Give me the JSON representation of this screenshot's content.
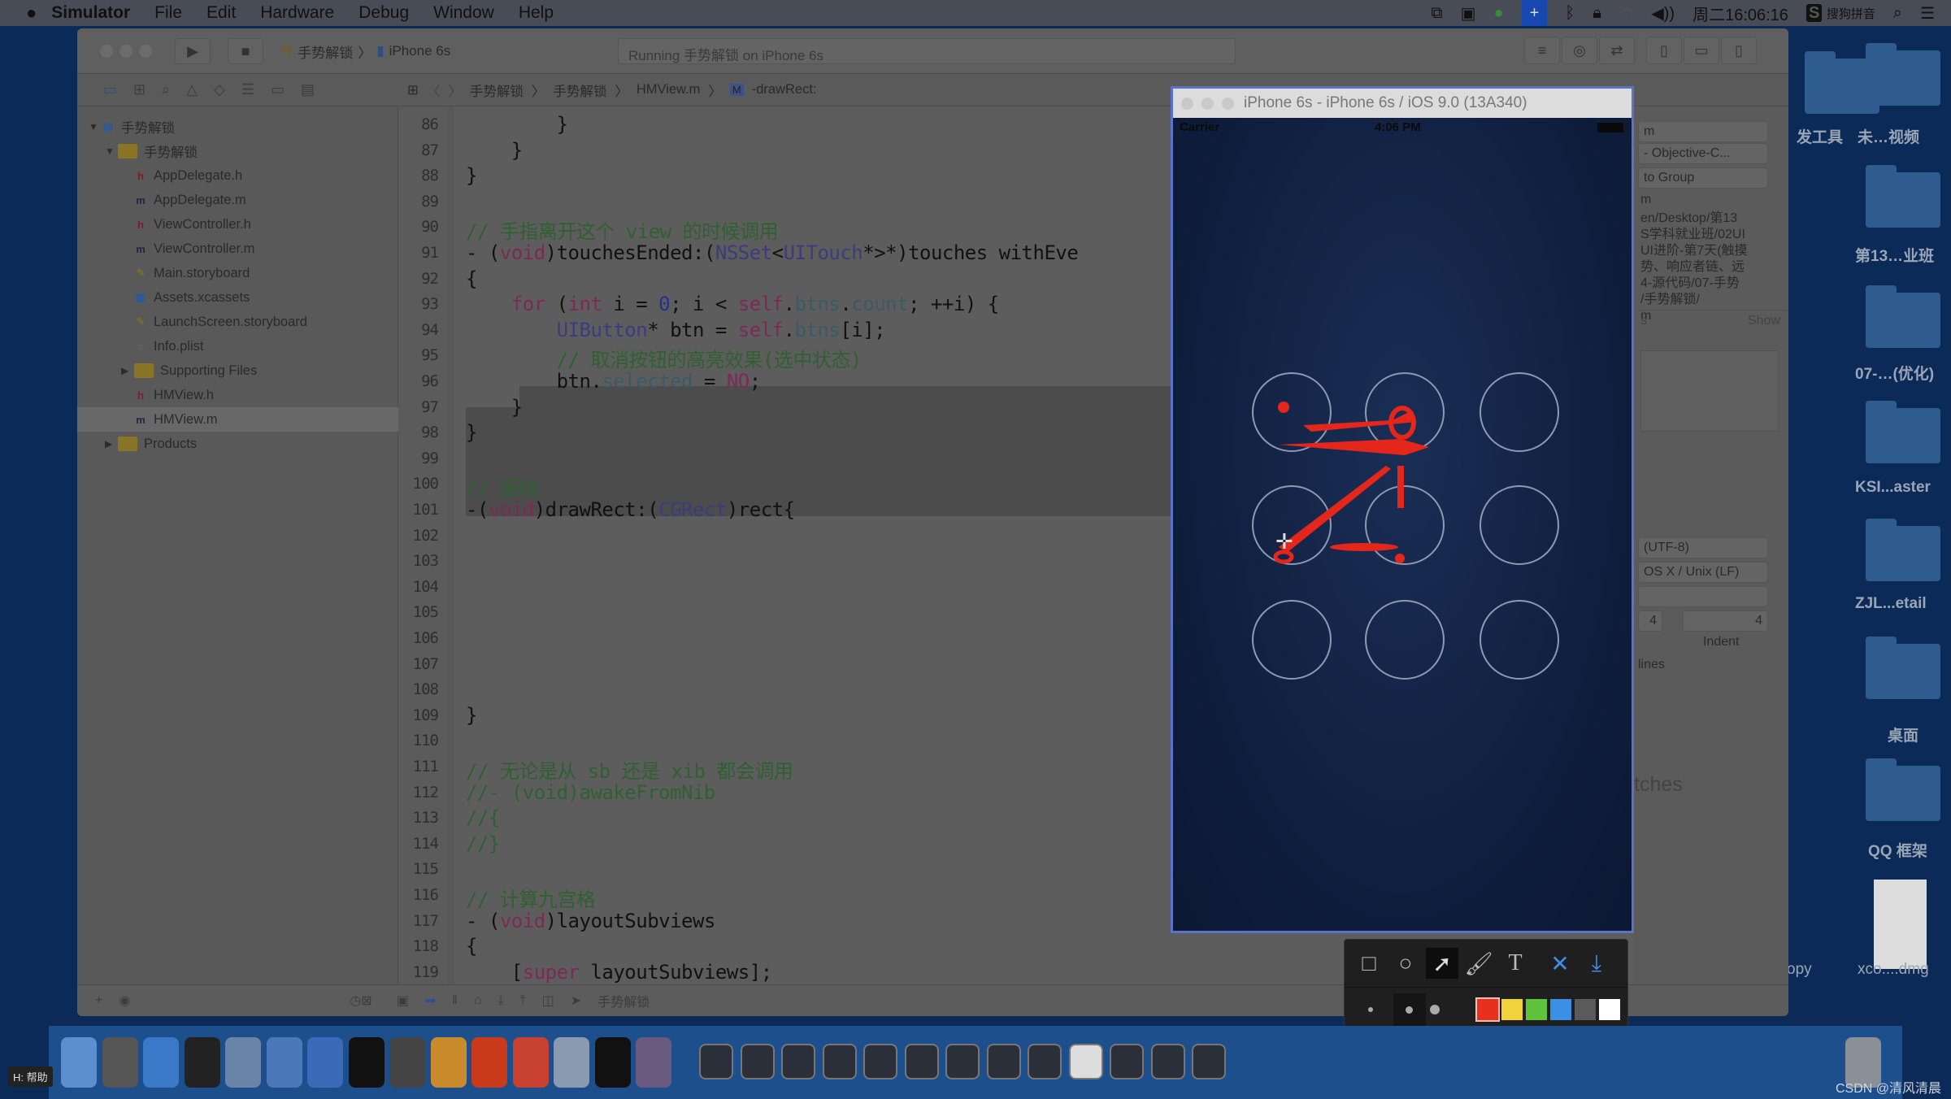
{
  "menubar": {
    "app": "Simulator",
    "items": [
      "File",
      "Edit",
      "Hardware",
      "Debug",
      "Window",
      "Help"
    ],
    "clock": "周二16:06:16",
    "ime": "搜狗拼音"
  },
  "xcode": {
    "scheme": "手势解锁",
    "device": "iPhone 6s",
    "activity": "Running 手势解锁 on iPhone 6s",
    "jumpbar": [
      "手势解锁",
      "手势解锁",
      "HMView.m",
      "-drawRect:"
    ],
    "tree": [
      {
        "label": "手势解锁",
        "type": "project",
        "depth": 0,
        "open": true
      },
      {
        "label": "手势解锁",
        "type": "folder",
        "depth": 1,
        "open": true
      },
      {
        "label": "AppDelegate.h",
        "type": "h",
        "depth": 2
      },
      {
        "label": "AppDelegate.m",
        "type": "m",
        "depth": 2
      },
      {
        "label": "ViewController.h",
        "type": "h",
        "depth": 2
      },
      {
        "label": "ViewController.m",
        "type": "m",
        "depth": 2
      },
      {
        "label": "Main.storyboard",
        "type": "sb",
        "depth": 2
      },
      {
        "label": "Assets.xcassets",
        "type": "assets",
        "depth": 2
      },
      {
        "label": "LaunchScreen.storyboard",
        "type": "sb",
        "depth": 2
      },
      {
        "label": "Info.plist",
        "type": "plist",
        "depth": 2
      },
      {
        "label": "Supporting Files",
        "type": "folder",
        "depth": 2,
        "open": false
      },
      {
        "label": "HMView.h",
        "type": "h",
        "depth": 2
      },
      {
        "label": "HMView.m",
        "type": "m",
        "depth": 2,
        "selected": true
      },
      {
        "label": "Products",
        "type": "folder",
        "depth": 1,
        "open": false
      }
    ],
    "code": [
      {
        "n": "86",
        "t": [
          [
            "        }",
            ""
          ]
        ]
      },
      {
        "n": "87",
        "t": [
          [
            "    }",
            ""
          ]
        ]
      },
      {
        "n": "88",
        "t": [
          [
            "}",
            ""
          ]
        ]
      },
      {
        "n": "89",
        "t": []
      },
      {
        "n": "90",
        "t": [
          [
            "// 手指离开这个 view 的时候调用",
            "cm"
          ]
        ]
      },
      {
        "n": "91",
        "t": [
          [
            "- (",
            ""
          ],
          [
            "void",
            "k"
          ],
          [
            ")touchesEnded:(",
            ""
          ],
          [
            "NSSet",
            "ty"
          ],
          [
            "<",
            ""
          ],
          [
            "UITouch",
            "ty"
          ],
          [
            "*>*)touches withEve",
            ""
          ]
        ]
      },
      {
        "n": "92",
        "t": [
          [
            "{",
            ""
          ]
        ]
      },
      {
        "n": "93",
        "t": [
          [
            "    ",
            ""
          ],
          [
            "for",
            "k"
          ],
          [
            " (",
            ""
          ],
          [
            "int",
            "k"
          ],
          [
            " i = ",
            ""
          ],
          [
            "0",
            "nm"
          ],
          [
            "; i < ",
            ""
          ],
          [
            "self",
            "k"
          ],
          [
            ".",
            ""
          ],
          [
            "btns",
            "pr"
          ],
          [
            ".",
            ""
          ],
          [
            "count",
            "pr"
          ],
          [
            "; ++i) {",
            ""
          ]
        ]
      },
      {
        "n": "94",
        "t": [
          [
            "        ",
            ""
          ],
          [
            "UIButton",
            "ty"
          ],
          [
            "* btn = ",
            ""
          ],
          [
            "self",
            "k"
          ],
          [
            ".",
            ""
          ],
          [
            "btns",
            "pr"
          ],
          [
            "[i];",
            ""
          ]
        ]
      },
      {
        "n": "95",
        "t": [
          [
            "        // 取消按钮的高亮效果(选中状态)",
            "cm"
          ]
        ]
      },
      {
        "n": "96",
        "t": [
          [
            "        btn.",
            ""
          ],
          [
            "selected",
            "pr"
          ],
          [
            " = ",
            ""
          ],
          [
            "NO",
            "k"
          ],
          [
            ";",
            ""
          ]
        ]
      },
      {
        "n": "97",
        "t": [
          [
            "    }",
            ""
          ]
        ]
      },
      {
        "n": "98",
        "t": [
          [
            "}",
            ""
          ]
        ]
      },
      {
        "n": "99",
        "t": []
      },
      {
        "n": "100",
        "t": [
          [
            "// 画线",
            "cm"
          ]
        ]
      },
      {
        "n": "101",
        "t": [
          [
            "-(",
            ""
          ],
          [
            "void",
            "k"
          ],
          [
            ")drawRect:(",
            ""
          ],
          [
            "CGRect",
            "ty"
          ],
          [
            ")rect{",
            ""
          ]
        ]
      },
      {
        "n": "102",
        "t": []
      },
      {
        "n": "103",
        "t": []
      },
      {
        "n": "104",
        "t": []
      },
      {
        "n": "105",
        "t": []
      },
      {
        "n": "106",
        "t": []
      },
      {
        "n": "107",
        "t": []
      },
      {
        "n": "108",
        "t": []
      },
      {
        "n": "109",
        "t": [
          [
            "}",
            ""
          ]
        ]
      },
      {
        "n": "110",
        "t": []
      },
      {
        "n": "111",
        "t": [
          [
            "// 无论是从 sb 还是 xib 都会调用",
            "cm"
          ]
        ]
      },
      {
        "n": "112",
        "t": [
          [
            "//- (void)awakeFromNib",
            "cm"
          ]
        ]
      },
      {
        "n": "113",
        "t": [
          [
            "//{",
            "cm"
          ]
        ]
      },
      {
        "n": "114",
        "t": [
          [
            "//}",
            "cm"
          ]
        ]
      },
      {
        "n": "115",
        "t": []
      },
      {
        "n": "116",
        "t": [
          [
            "// 计算九宫格",
            "cm"
          ]
        ]
      },
      {
        "n": "117",
        "t": [
          [
            "- (",
            ""
          ],
          [
            "void",
            "k"
          ],
          [
            ")layoutSubviews",
            ""
          ]
        ]
      },
      {
        "n": "118",
        "t": [
          [
            "{",
            ""
          ]
        ]
      },
      {
        "n": "119",
        "t": [
          [
            "    [",
            ""
          ],
          [
            "super",
            "k"
          ],
          [
            " layoutSubviews];",
            ""
          ]
        ]
      }
    ],
    "inspector": {
      "name": "m",
      "type": "- Objective-C...",
      "location": "to Group",
      "fullpath_label": "m",
      "path": [
        "en/Desktop/第13",
        "S学科就业班/02UI",
        "UI进阶-第7天(触摸",
        "势、响应者链、远",
        "4-源代码/07-手势",
        "/手势解锁/"
      ],
      "path_end": "m",
      "show": "Show",
      "encoding": "(UTF-8)",
      "line_endings": "OS X / Unix (LF)",
      "tab": "4",
      "indent": "4",
      "indent_label": "Indent",
      "lines_label": "lines",
      "tches": "tches"
    },
    "debug_target": "手势解锁"
  },
  "simulator": {
    "title": "iPhone 6s - iPhone 6s / iOS 9.0 (13A340)",
    "carrier": "Carrier",
    "time": "4:06 PM"
  },
  "desktop": [
    "发工具",
    "未…视频",
    "第13…业班",
    "07-…(优化)",
    "KSI...aster",
    "ZJL...etail",
    "桌面",
    "QQ 框架",
    "opy",
    "xco....dmg"
  ],
  "screenshot_tools": {
    "tools": [
      "rectangle-icon",
      "ellipse-icon",
      "arrow-icon",
      "brush-icon",
      "text-icon",
      "cancel-icon",
      "download-icon"
    ],
    "colors": [
      "#e8301f",
      "#f1d23a",
      "#5ec23a",
      "#3b8fe4",
      "#5a5a5a",
      "#ffffff"
    ],
    "selected_color": "#e8301f"
  },
  "help_badge": "H: 帮助",
  "watermark": "CSDN @清风清晨"
}
